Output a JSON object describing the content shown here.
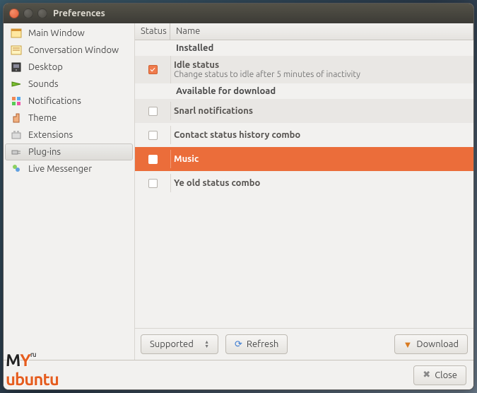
{
  "window": {
    "title": "Preferences"
  },
  "sidebar": {
    "items": [
      {
        "label": "Main Window",
        "icon": "main-window-icon"
      },
      {
        "label": "Conversation Window",
        "icon": "conversation-icon"
      },
      {
        "label": "Desktop",
        "icon": "desktop-icon"
      },
      {
        "label": "Sounds",
        "icon": "sounds-icon"
      },
      {
        "label": "Notifications",
        "icon": "notifications-icon"
      },
      {
        "label": "Theme",
        "icon": "theme-icon"
      },
      {
        "label": "Extensions",
        "icon": "extensions-icon"
      },
      {
        "label": "Plug-ins",
        "icon": "plugins-icon",
        "selected": true
      },
      {
        "label": "Live Messenger",
        "icon": "live-messenger-icon"
      }
    ]
  },
  "table": {
    "headers": {
      "status": "Status",
      "name": "Name"
    },
    "sections": [
      {
        "title": "Installed",
        "rows": [
          {
            "checked": true,
            "name": "Idle status",
            "desc": "Change status to idle after 5 minutes of inactivity",
            "alt": true
          }
        ]
      },
      {
        "title": "Available for download",
        "rows": [
          {
            "checked": false,
            "name": "Snarl notifications",
            "alt": true
          },
          {
            "checked": false,
            "name": "Contact status history combo",
            "alt": false
          },
          {
            "checked": false,
            "name": "Music",
            "selected": true
          },
          {
            "checked": false,
            "name": "Ye old status combo",
            "alt": false
          }
        ]
      }
    ]
  },
  "toolbar": {
    "filter": "Supported",
    "refresh": "Refresh",
    "download": "Download"
  },
  "footer": {
    "close": "Close"
  },
  "watermark": {
    "prefix": "M",
    "y": "Y",
    "text": "ubuntu",
    "suffix": "ru"
  }
}
